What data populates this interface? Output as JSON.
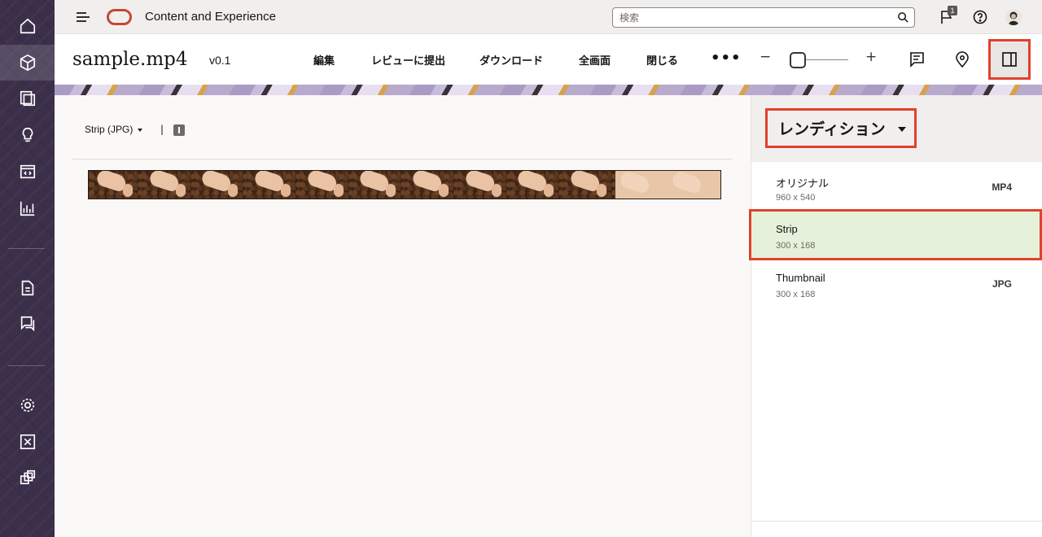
{
  "topbar": {
    "app_title": "Content and Experience",
    "search_placeholder": "検索",
    "notification_count": "1"
  },
  "header": {
    "file_name": "sample.mp4",
    "version": "v0.1",
    "actions": {
      "edit": "編集",
      "submit_review": "レビューに提出",
      "download": "ダウンロード",
      "fullscreen": "全画面",
      "close": "閉じる"
    },
    "more": "•••",
    "zoom_minus": "−",
    "zoom_plus": "+"
  },
  "main": {
    "strip_select": "Strip (JPG)",
    "pipe": "|"
  },
  "panel": {
    "title": "レンディション",
    "renditions": [
      {
        "name": "オリジナル",
        "size": "960 x 540",
        "format": "MP4"
      },
      {
        "name": "Strip",
        "size": "300 x 168",
        "format": ""
      },
      {
        "name": "Thumbnail",
        "size": "300 x 168",
        "format": "JPG"
      }
    ],
    "selected_index": 1
  },
  "colors": {
    "rail": "#3b2f4a",
    "accent_highlight": "#e0412c",
    "brand": "#c74634",
    "selected_row": "#e5f1da"
  },
  "icons": {
    "rail": [
      "home-icon",
      "assets-cube-icon",
      "collections-icon",
      "ideas-lightbulb-icon",
      "sites-icon",
      "analytics-icon",
      "documents-icon",
      "conversations-icon",
      "settings-gear-icon",
      "integrations-icon",
      "content-types-icon"
    ],
    "topbar": [
      "hamburger-icon",
      "oracle-logo",
      "search-icon",
      "flag-icon",
      "help-icon",
      "avatar"
    ],
    "header": [
      "comment-icon",
      "location-pin-icon",
      "side-panel-icon"
    ]
  }
}
